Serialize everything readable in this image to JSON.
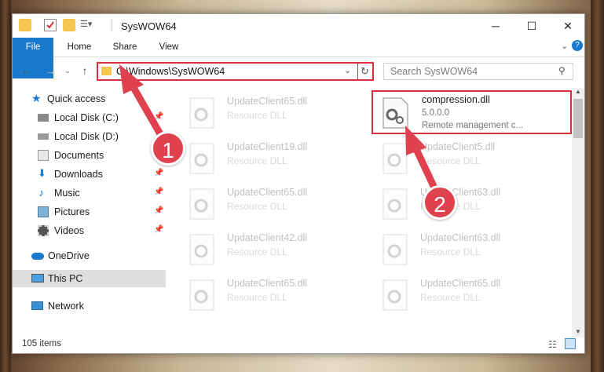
{
  "window": {
    "title": "SysWOW64"
  },
  "ribbon": {
    "tabs": [
      "File",
      "Home",
      "Share",
      "View"
    ]
  },
  "nav": {
    "address": "C:\\Windows\\SysWOW64",
    "search_placeholder": "Search SysWOW64"
  },
  "sidebar": {
    "items": [
      {
        "label": "Quick access",
        "icon": "star-icon"
      },
      {
        "label": "Local Disk (C:)",
        "icon": "drive-icon"
      },
      {
        "label": "Local Disk (D:)",
        "icon": "drive-icon"
      },
      {
        "label": "Documents",
        "icon": "documents-icon"
      },
      {
        "label": "Downloads",
        "icon": "download-icon"
      },
      {
        "label": "Music",
        "icon": "music-icon"
      },
      {
        "label": "Pictures",
        "icon": "pictures-icon"
      },
      {
        "label": "Videos",
        "icon": "videos-icon"
      },
      {
        "label": "OneDrive",
        "icon": "cloud-icon"
      },
      {
        "label": "This PC",
        "icon": "computer-icon"
      },
      {
        "label": "Network",
        "icon": "network-icon"
      }
    ]
  },
  "files": [
    {
      "name": "UpdateClient65.dll",
      "type": "Resource DLL"
    },
    {
      "name": "compression.dll",
      "version": "5.0.0.0",
      "desc": "Remote management c..."
    },
    {
      "name": "UpdateClient19.dll",
      "type": "Resource DLL"
    },
    {
      "name": "UpdateClient5.dll",
      "type": "Resource DLL"
    },
    {
      "name": "UpdateClient65.dll",
      "type": "Resource DLL"
    },
    {
      "name": "UpdateClient63.dll",
      "type": "Resource DLL"
    },
    {
      "name": "UpdateClient42.dll",
      "type": "Resource DLL"
    },
    {
      "name": "UpdateClient63.dll",
      "type": "Resource DLL"
    },
    {
      "name": "UpdateClient65.dll",
      "type": "Resource DLL"
    },
    {
      "name": "UpdateClient65.dll",
      "type": "Resource DLL"
    }
  ],
  "status": {
    "count": "105 items"
  },
  "callouts": [
    "1",
    "2"
  ],
  "colors": {
    "accent": "#1979ca",
    "highlight": "#d9303a",
    "callout": "#e0414e"
  }
}
